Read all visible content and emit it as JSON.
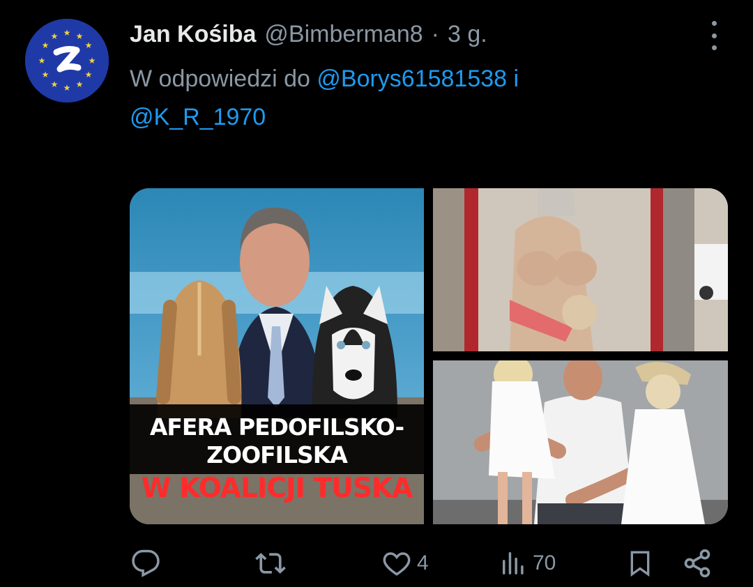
{
  "tweet": {
    "author_name": "Jan Kośiba",
    "handle": "@Bimberman8",
    "separator": "·",
    "time": "3 g.",
    "reply_prefix": "W odpowiedzi do",
    "reply_user_1": "@Borys61581538",
    "reply_conj": "i",
    "reply_user_2": "@K_R_1970"
  },
  "media": {
    "image1_caption_line1": "AFERA PEDOFILSKO-",
    "image1_caption_line2": "ZOOFILSKA",
    "image1_caption_line3": "W KOALICJI TUSKA"
  },
  "actions": {
    "reply_icon": "comment-icon",
    "retweet_icon": "retweet-icon",
    "like_icon": "heart-icon",
    "like_count": "4",
    "views_icon": "views-icon",
    "views_count": "70",
    "bookmark_icon": "bookmark-icon",
    "share_icon": "share-icon"
  },
  "colors": {
    "background": "#000000",
    "text_primary": "#e7e9ea",
    "text_secondary": "#8b98a5",
    "link": "#1d9bf0",
    "caption_red": "#ff2b2b"
  }
}
